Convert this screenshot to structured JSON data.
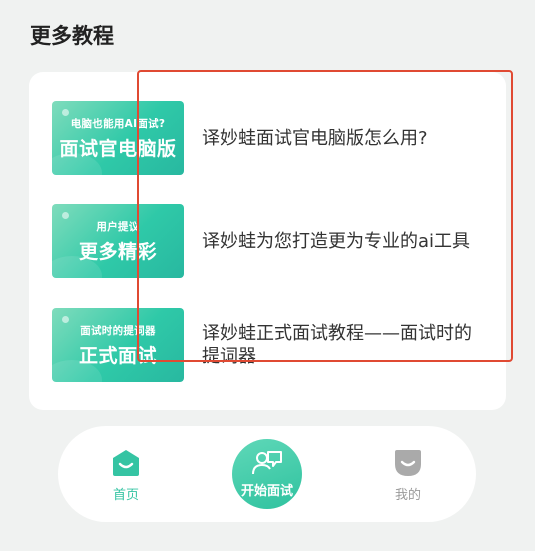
{
  "section": {
    "title": "更多教程"
  },
  "tutorials": [
    {
      "thumb_small": "电脑也能用AI面试?",
      "thumb_big": "面试官电脑版",
      "title": "译妙蛙面试官电脑版怎么用?"
    },
    {
      "thumb_small": "用户提议",
      "thumb_big": "更多精彩",
      "title": "译妙蛙为您打造更为专业的ai工具"
    },
    {
      "thumb_small": "面试时的提词器",
      "thumb_big": "正式面试",
      "title": "译妙蛙正式面试教程——面试时的提词器"
    }
  ],
  "nav": {
    "home_label": "首页",
    "start_label": "开始面试",
    "me_label": "我的"
  },
  "colors": {
    "accent": "#35c4a3",
    "highlight_border": "#e04a33"
  }
}
